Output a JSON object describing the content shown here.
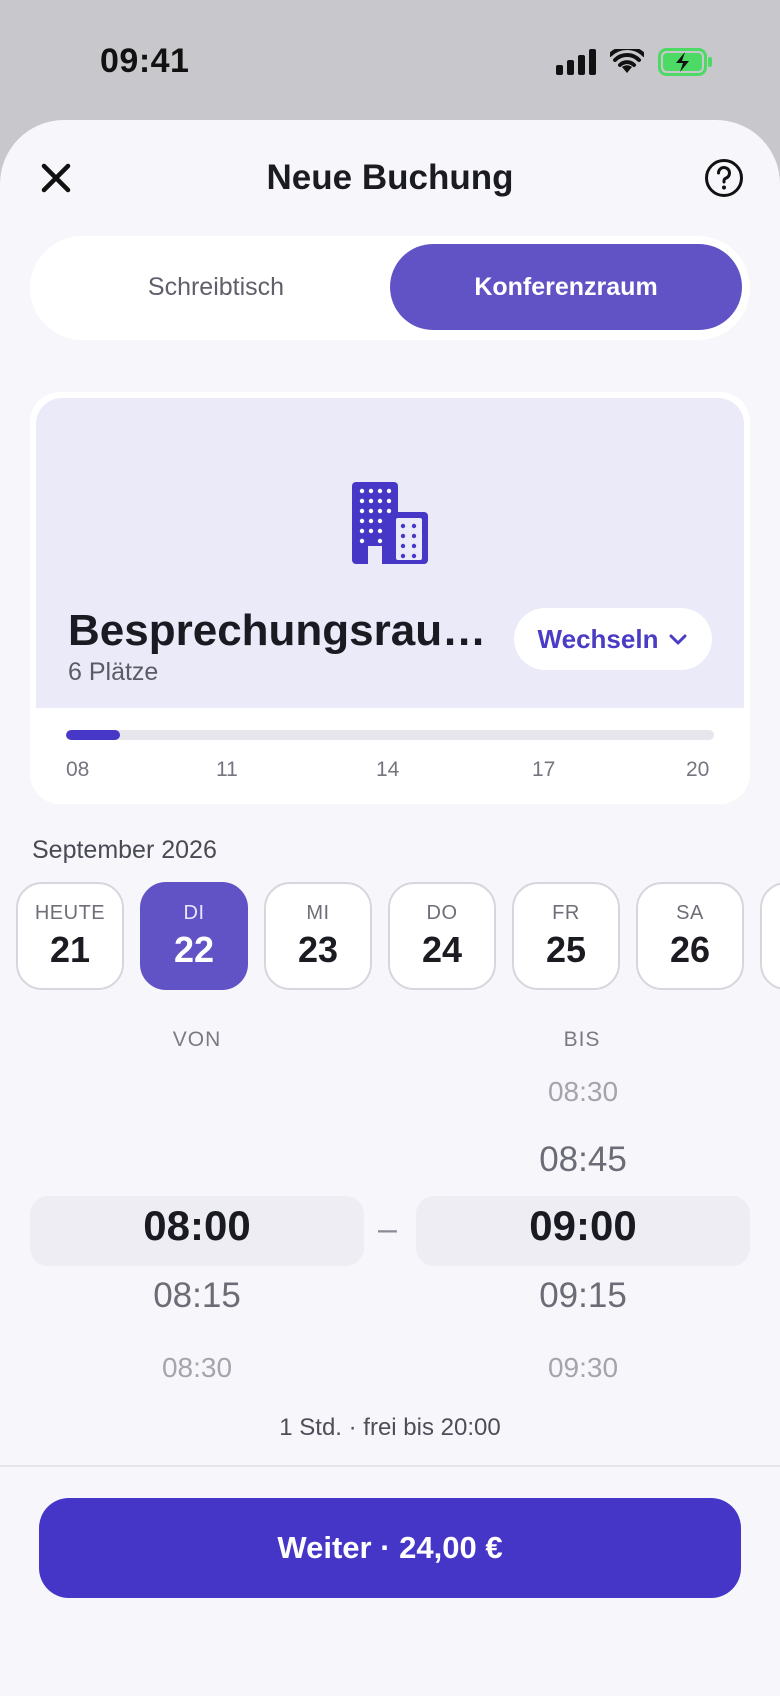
{
  "status_bar": {
    "time": "09:41"
  },
  "header": {
    "title": "Neue Buchung",
    "close_icon": "close-icon",
    "help_icon": "help-icon"
  },
  "segments": [
    {
      "label": "Schreibtisch",
      "selected": false
    },
    {
      "label": "Konferenzraum",
      "selected": true
    }
  ],
  "room": {
    "name": "Besprechungsraum Nord",
    "seats": "6 Plätze",
    "switch_label": "Wechseln",
    "icon": "building-icon"
  },
  "timeline": {
    "ticks": [
      "08",
      "11",
      "14",
      "17",
      "20"
    ],
    "booked_fraction": 0.083
  },
  "calendar": {
    "month": "September 2026",
    "days": [
      {
        "dow": "HEUTE",
        "num": "21",
        "selected": false
      },
      {
        "dow": "DI",
        "num": "22",
        "selected": true
      },
      {
        "dow": "MI",
        "num": "23",
        "selected": false
      },
      {
        "dow": "DO",
        "num": "24",
        "selected": false
      },
      {
        "dow": "FR",
        "num": "25",
        "selected": false
      },
      {
        "dow": "SA",
        "num": "26",
        "selected": false
      }
    ]
  },
  "time_picker": {
    "from_label": "VON",
    "to_label": "BIS",
    "from": {
      "selected": "08:00",
      "after": [
        "08:15",
        "08:30"
      ]
    },
    "to": {
      "before": [
        "08:30",
        "08:45"
      ],
      "selected": "09:00",
      "after": [
        "09:15",
        "09:30"
      ]
    },
    "separator": "–",
    "duration": "1 Std. · frei bis 20:00"
  },
  "cta": {
    "label": "Weiter · 24,00 €"
  },
  "colors": {
    "accent": "#6153c6",
    "cta": "#4536c8",
    "battery": "#4cd964"
  }
}
